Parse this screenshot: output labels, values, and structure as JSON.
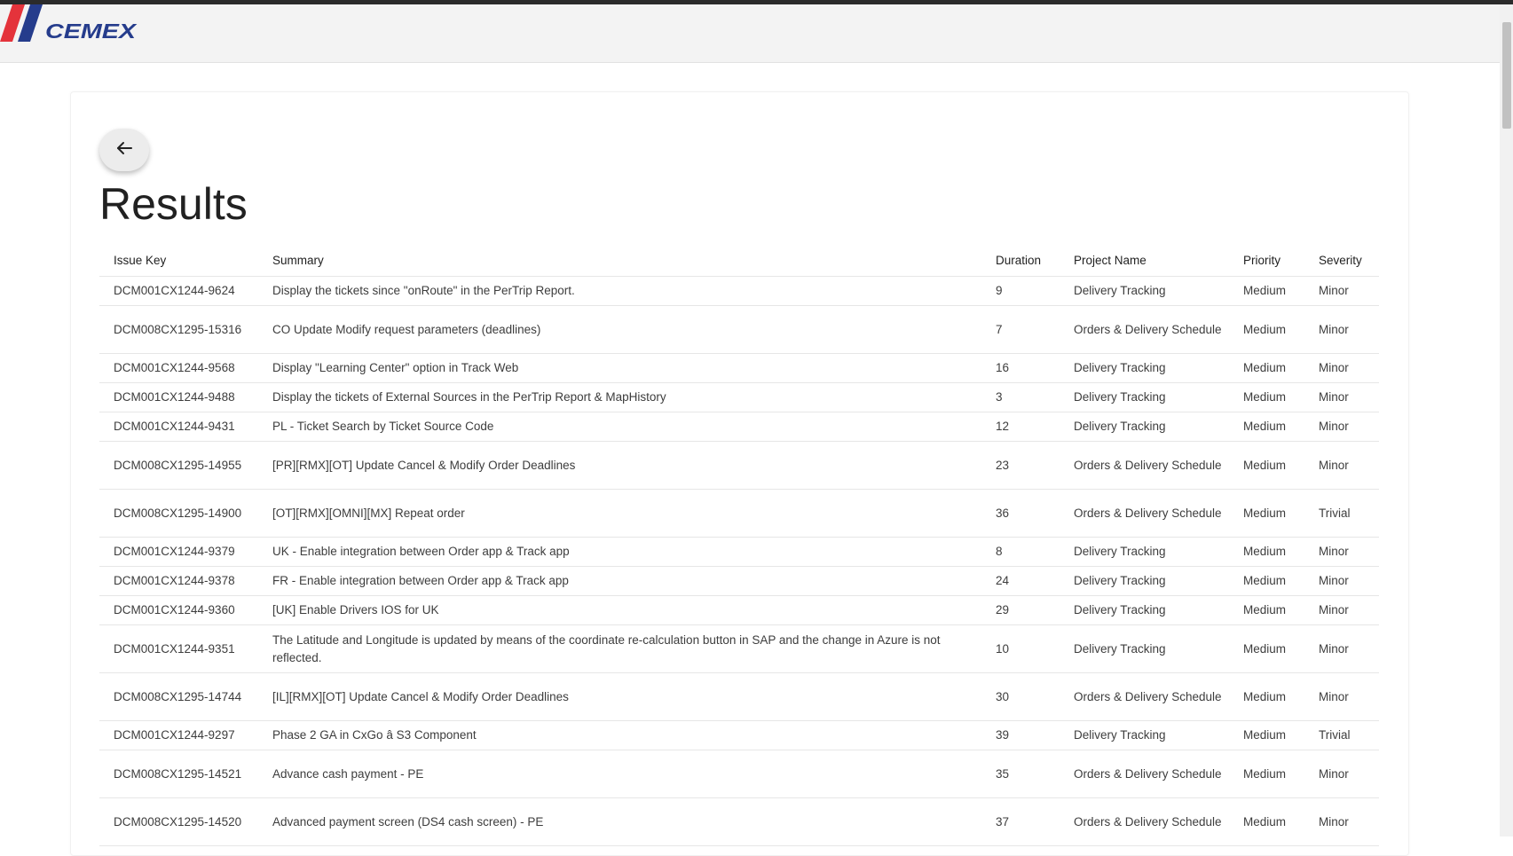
{
  "app": {
    "brand": "CEMEX",
    "brand_colors": {
      "red": "#e4333b",
      "blue": "#253c8c"
    }
  },
  "page": {
    "title": "Results",
    "back_icon": "arrow-left-icon"
  },
  "table": {
    "columns": [
      "Issue Key",
      "Summary",
      "Duration",
      "Project Name",
      "Priority",
      "Severity"
    ],
    "rows": [
      {
        "key": "DCM001CX1244-9624",
        "summary": "Display the tickets since \"onRoute\" in the PerTrip Report.",
        "duration": "9",
        "project": "Delivery Tracking",
        "priority": "Medium",
        "severity": "Minor"
      },
      {
        "key": "DCM008CX1295-15316",
        "summary": "CO Update Modify request parameters (deadlines)",
        "duration": "7",
        "project": "Orders & Delivery Schedule",
        "priority": "Medium",
        "severity": "Minor"
      },
      {
        "key": "DCM001CX1244-9568",
        "summary": "Display \"Learning Center\" option in Track Web",
        "duration": "16",
        "project": "Delivery Tracking",
        "priority": "Medium",
        "severity": "Minor"
      },
      {
        "key": "DCM001CX1244-9488",
        "summary": "Display the tickets of External Sources in the PerTrip Report & MapHistory",
        "duration": "3",
        "project": "Delivery Tracking",
        "priority": "Medium",
        "severity": "Minor"
      },
      {
        "key": "DCM001CX1244-9431",
        "summary": "PL - Ticket Search by Ticket Source Code",
        "duration": "12",
        "project": "Delivery Tracking",
        "priority": "Medium",
        "severity": "Minor"
      },
      {
        "key": "DCM008CX1295-14955",
        "summary": "[PR][RMX][OT] Update Cancel & Modify Order Deadlines",
        "duration": "23",
        "project": "Orders & Delivery Schedule",
        "priority": "Medium",
        "severity": "Minor"
      },
      {
        "key": "DCM008CX1295-14900",
        "summary": "[OT][RMX][OMNI][MX] Repeat order",
        "duration": "36",
        "project": "Orders & Delivery Schedule",
        "priority": "Medium",
        "severity": "Trivial"
      },
      {
        "key": "DCM001CX1244-9379",
        "summary": "UK - Enable integration between Order app & Track app",
        "duration": "8",
        "project": "Delivery Tracking",
        "priority": "Medium",
        "severity": "Minor"
      },
      {
        "key": "DCM001CX1244-9378",
        "summary": "FR - Enable integration between Order app & Track app",
        "duration": "24",
        "project": "Delivery Tracking",
        "priority": "Medium",
        "severity": "Minor"
      },
      {
        "key": "DCM001CX1244-9360",
        "summary": "[UK] Enable Drivers IOS for UK",
        "duration": "29",
        "project": "Delivery Tracking",
        "priority": "Medium",
        "severity": "Minor"
      },
      {
        "key": "DCM001CX1244-9351",
        "summary": "The Latitude and Longitude is updated by means of the coordinate re-calculation button in SAP and the change in Azure is not reflected.",
        "duration": "10",
        "project": "Delivery Tracking",
        "priority": "Medium",
        "severity": "Minor"
      },
      {
        "key": "DCM008CX1295-14744",
        "summary": "[IL][RMX][OT] Update Cancel & Modify Order Deadlines",
        "duration": "30",
        "project": "Orders & Delivery Schedule",
        "priority": "Medium",
        "severity": "Minor"
      },
      {
        "key": "DCM001CX1244-9297",
        "summary": "Phase 2 GA in CxGo â S3 Component",
        "duration": "39",
        "project": "Delivery Tracking",
        "priority": "Medium",
        "severity": "Trivial"
      },
      {
        "key": "DCM008CX1295-14521",
        "summary": "Advance cash payment - PE",
        "duration": "35",
        "project": "Orders & Delivery Schedule",
        "priority": "Medium",
        "severity": "Minor"
      },
      {
        "key": "DCM008CX1295-14520",
        "summary": "Advanced payment screen (DS4 cash screen) - PE",
        "duration": "37",
        "project": "Orders & Delivery Schedule",
        "priority": "Medium",
        "severity": "Minor"
      }
    ]
  }
}
